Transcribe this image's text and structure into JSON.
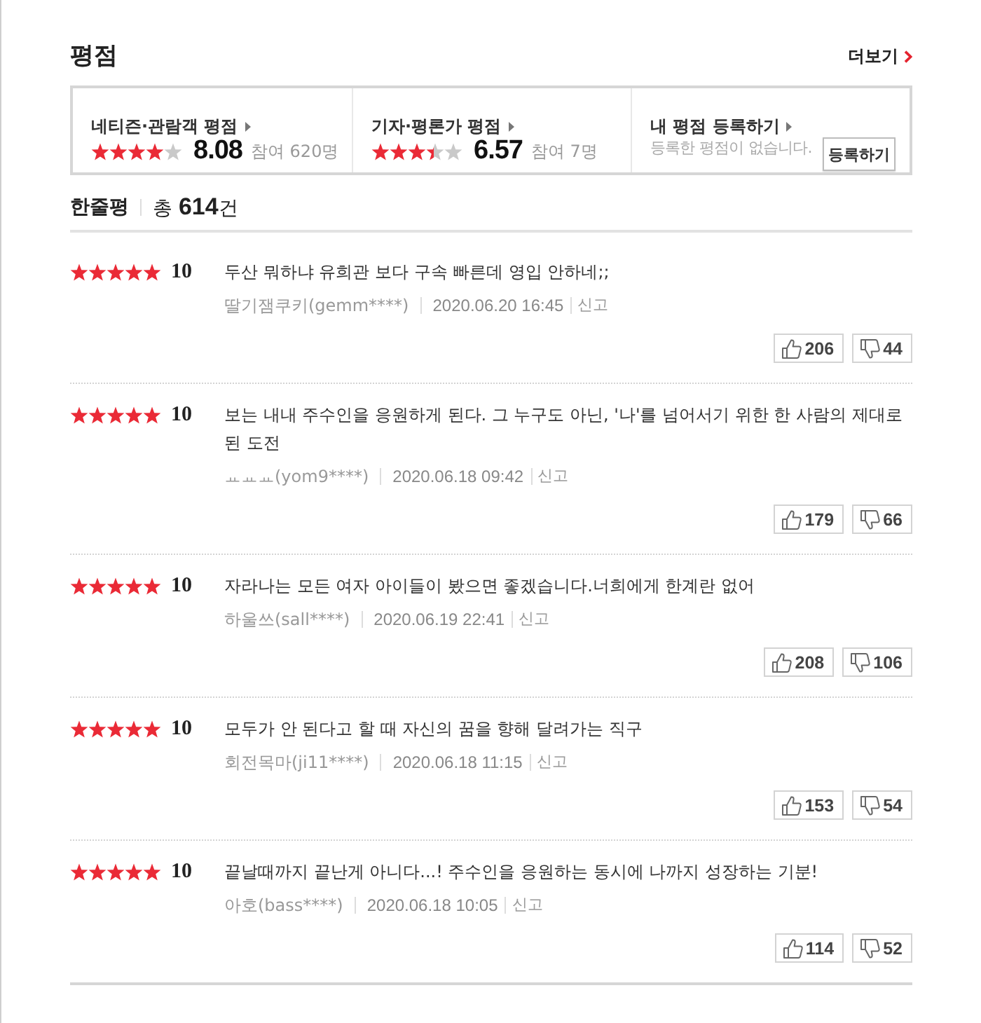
{
  "section": {
    "title": "평점",
    "more_link": "더보기"
  },
  "rating_summary": [
    {
      "kind": "score",
      "label": "네티즌·관람객 평점",
      "stars": 4,
      "score": "8.08",
      "participants": "참여 620명"
    },
    {
      "kind": "score",
      "label": "기자·평론가 평점",
      "stars": 3.4,
      "score": "6.57",
      "participants": "참여 7명"
    },
    {
      "kind": "register",
      "label": "내 평점 등록하기",
      "message": "등록한 평점이 없습니다.",
      "button": "등록하기"
    }
  ],
  "reviews_header": {
    "title": "한줄평",
    "total": "총 **614**건"
  },
  "reviews": [
    {
      "stars": 5,
      "score": "10",
      "text": "두산 뭐하냐 유희관 보다 구속 빠른데 영입 안하네;;",
      "author": "딸기잼쿠키(gemm****)",
      "date": "2020.06.20 16:45",
      "report": "신고",
      "likes": "206",
      "dislikes": "44"
    },
    {
      "stars": 5,
      "score": "10",
      "text": "보는 내내 주수인을 응원하게 된다. 그 누구도 아닌, '나'를 넘어서기 위한 한 사람의 제대로 된 도전",
      "author": "ㅛㅛㅛ(yom9****)",
      "date": "2020.06.18 09:42",
      "report": "신고",
      "likes": "179",
      "dislikes": "66"
    },
    {
      "stars": 5,
      "score": "10",
      "text": "자라나는 모든 여자 아이들이 봤으면 좋겠습니다.너희에게 한계란 없어",
      "author": "하울쓰(sall****)",
      "date": "2020.06.19 22:41",
      "report": "신고",
      "likes": "208",
      "dislikes": "106"
    },
    {
      "stars": 5,
      "score": "10",
      "text": "모두가 안 된다고 할 때 자신의 꿈을 향해 달려가는 직구",
      "author": "회전목마(ji11****)",
      "date": "2020.06.18 11:15",
      "report": "신고",
      "likes": "153",
      "dislikes": "54"
    },
    {
      "stars": 5,
      "score": "10",
      "text": "끝날때까지 끝난게 아니다...! 주수인을 응원하는 동시에 나까지 성장하는 기분!",
      "author": "아호(bass****)",
      "date": "2020.06.18 10:05",
      "report": "신고",
      "likes": "114",
      "dislikes": "52"
    }
  ]
}
